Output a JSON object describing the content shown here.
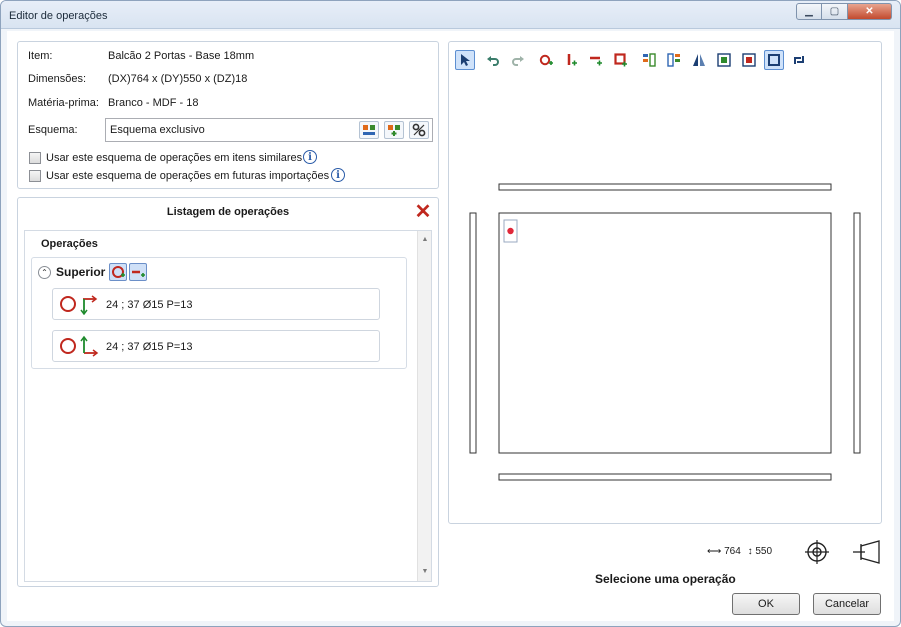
{
  "window": {
    "title": "Editor de operações"
  },
  "info": {
    "item_label": "Item:",
    "item_value": "Balcão 2 Portas - Base 18mm",
    "dimensions_label": "Dimensões:",
    "dimensions_value": "(DX)764 x (DY)550 x (DZ)18",
    "material_label": "Matéria-prima:",
    "material_value": "Branco - MDF - 18",
    "scheme_label": "Esquema:",
    "scheme_value": "Esquema exclusivo",
    "check_similar": "Usar este esquema de operações em itens similares",
    "check_future": "Usar este esquema de operações em futuras importações"
  },
  "list": {
    "title": "Listagem de operações",
    "operations_label": "Operações",
    "group_name": "Superior",
    "operations": [
      {
        "text": "24 ; 37 Ø15 P=13"
      },
      {
        "text": "24 ; 37 Ø15 P=13"
      }
    ]
  },
  "status": {
    "width_value": "764",
    "height_value": "550",
    "message": "Selecione uma operação"
  },
  "buttons": {
    "ok": "OK",
    "cancel": "Cancelar"
  },
  "colors": {
    "accent": "#c0281e",
    "selection": "#cfe2fa",
    "border": "#c9d3df"
  },
  "icons": [
    "pointer-icon",
    "undo-icon",
    "redo-icon",
    "hole-icon",
    "vertical-cut-icon",
    "horizontal-cut-icon",
    "pocket-icon",
    "align-top-icon",
    "align-bottom-icon",
    "mirror-icon",
    "face-front-icon",
    "face-back-icon",
    "face-edges-icon",
    "rotate-icon"
  ]
}
